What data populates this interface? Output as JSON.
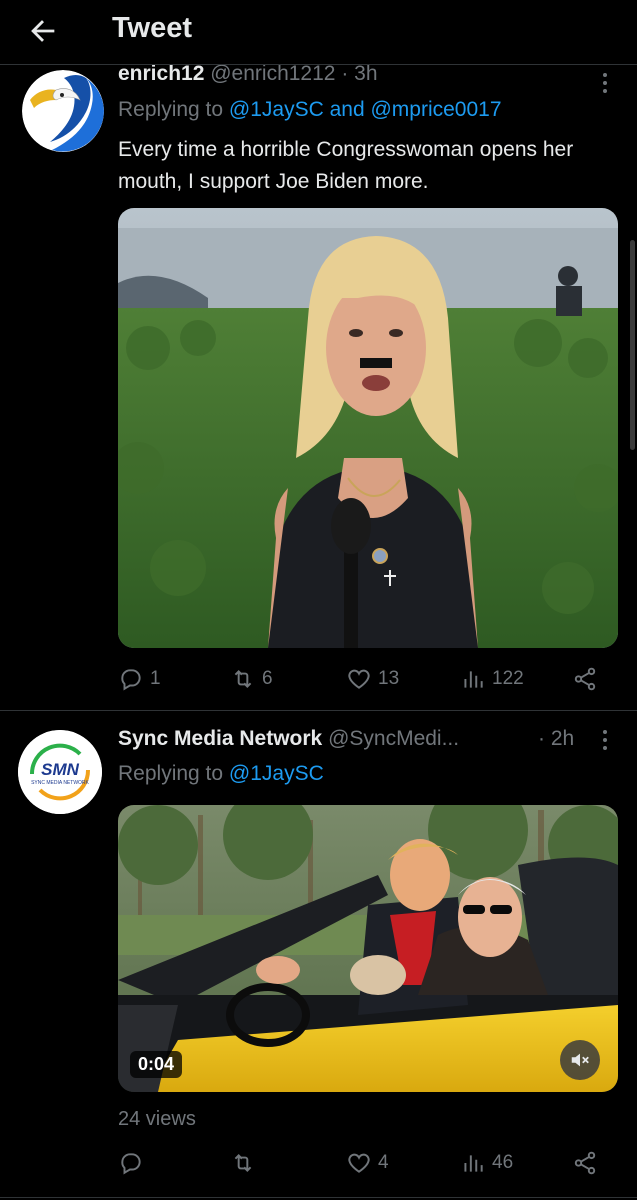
{
  "header": {
    "title": "Tweet",
    "back_icon": "arrow-left-icon"
  },
  "tweets": [
    {
      "name": "enrich12",
      "handle": "@enrich1212",
      "separator": "·",
      "time": "3h",
      "reply_prefix": "Replying to ",
      "reply_mentions": "@1JaySC and @mprice0017",
      "text": "Every time a horrible Congresswoman opens her mouth, I support Joe Biden more.",
      "actions": {
        "replies": "1",
        "retweets": "6",
        "likes": "13",
        "views": "122"
      }
    },
    {
      "name": "Sync Media Network",
      "handle": "@SyncMedi...",
      "separator": "·",
      "time": "2h",
      "reply_prefix": "Replying to ",
      "reply_mentions": "@1JaySC",
      "avatar_text": "SMN",
      "avatar_subtext": "SYNC MEDIA NETWORK",
      "video_duration": "0:04",
      "views_text": "24 views",
      "actions": {
        "replies": "",
        "retweets": "",
        "likes": "4",
        "views": "46"
      }
    }
  ],
  "colors": {
    "background": "#000000",
    "accent": "#1d9bf0",
    "muted": "#71767b",
    "divider": "#2f3336"
  }
}
